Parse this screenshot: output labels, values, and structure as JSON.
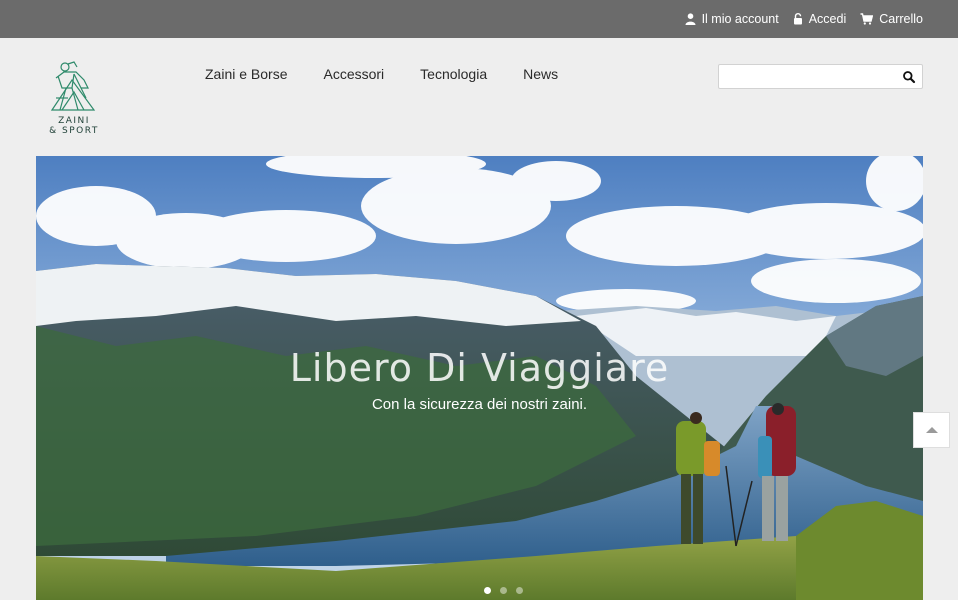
{
  "topbar": {
    "account_label": "Il mio account",
    "login_label": "Accedi",
    "cart_label": "Carrello"
  },
  "logo": {
    "line1": "ZAINI",
    "line2": "& SPORT"
  },
  "nav": {
    "items": [
      "Zaini e Borse",
      "Accessori",
      "Tecnologia",
      "News"
    ]
  },
  "search": {
    "value": "",
    "placeholder": ""
  },
  "hero": {
    "title": "Libero Di Viaggiare",
    "subtitle": "Con la sicurezza dei nostri zaini.",
    "slide_count": 3,
    "active_slide": 1
  },
  "colors": {
    "topbar": "#6b6b6b",
    "page_bg": "#eeeeee",
    "logo_accent": "#2f8a6b"
  },
  "icons": [
    "user-icon",
    "lock-icon",
    "cart-icon",
    "search-icon",
    "caret-up-icon"
  ]
}
